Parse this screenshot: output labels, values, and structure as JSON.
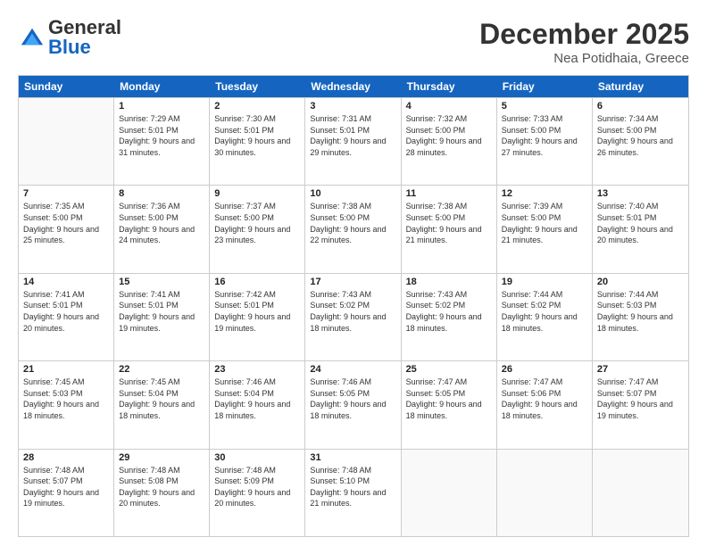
{
  "logo": {
    "general": "General",
    "blue": "Blue"
  },
  "header": {
    "month": "December 2025",
    "location": "Nea Potidhaia, Greece"
  },
  "weekdays": [
    "Sunday",
    "Monday",
    "Tuesday",
    "Wednesday",
    "Thursday",
    "Friday",
    "Saturday"
  ],
  "weeks": [
    [
      {
        "day": "",
        "empty": true
      },
      {
        "day": "1",
        "sunrise": "Sunrise: 7:29 AM",
        "sunset": "Sunset: 5:01 PM",
        "daylight": "Daylight: 9 hours and 31 minutes."
      },
      {
        "day": "2",
        "sunrise": "Sunrise: 7:30 AM",
        "sunset": "Sunset: 5:01 PM",
        "daylight": "Daylight: 9 hours and 30 minutes."
      },
      {
        "day": "3",
        "sunrise": "Sunrise: 7:31 AM",
        "sunset": "Sunset: 5:01 PM",
        "daylight": "Daylight: 9 hours and 29 minutes."
      },
      {
        "day": "4",
        "sunrise": "Sunrise: 7:32 AM",
        "sunset": "Sunset: 5:00 PM",
        "daylight": "Daylight: 9 hours and 28 minutes."
      },
      {
        "day": "5",
        "sunrise": "Sunrise: 7:33 AM",
        "sunset": "Sunset: 5:00 PM",
        "daylight": "Daylight: 9 hours and 27 minutes."
      },
      {
        "day": "6",
        "sunrise": "Sunrise: 7:34 AM",
        "sunset": "Sunset: 5:00 PM",
        "daylight": "Daylight: 9 hours and 26 minutes."
      }
    ],
    [
      {
        "day": "7",
        "sunrise": "Sunrise: 7:35 AM",
        "sunset": "Sunset: 5:00 PM",
        "daylight": "Daylight: 9 hours and 25 minutes."
      },
      {
        "day": "8",
        "sunrise": "Sunrise: 7:36 AM",
        "sunset": "Sunset: 5:00 PM",
        "daylight": "Daylight: 9 hours and 24 minutes."
      },
      {
        "day": "9",
        "sunrise": "Sunrise: 7:37 AM",
        "sunset": "Sunset: 5:00 PM",
        "daylight": "Daylight: 9 hours and 23 minutes."
      },
      {
        "day": "10",
        "sunrise": "Sunrise: 7:38 AM",
        "sunset": "Sunset: 5:00 PM",
        "daylight": "Daylight: 9 hours and 22 minutes."
      },
      {
        "day": "11",
        "sunrise": "Sunrise: 7:38 AM",
        "sunset": "Sunset: 5:00 PM",
        "daylight": "Daylight: 9 hours and 21 minutes."
      },
      {
        "day": "12",
        "sunrise": "Sunrise: 7:39 AM",
        "sunset": "Sunset: 5:00 PM",
        "daylight": "Daylight: 9 hours and 21 minutes."
      },
      {
        "day": "13",
        "sunrise": "Sunrise: 7:40 AM",
        "sunset": "Sunset: 5:01 PM",
        "daylight": "Daylight: 9 hours and 20 minutes."
      }
    ],
    [
      {
        "day": "14",
        "sunrise": "Sunrise: 7:41 AM",
        "sunset": "Sunset: 5:01 PM",
        "daylight": "Daylight: 9 hours and 20 minutes."
      },
      {
        "day": "15",
        "sunrise": "Sunrise: 7:41 AM",
        "sunset": "Sunset: 5:01 PM",
        "daylight": "Daylight: 9 hours and 19 minutes."
      },
      {
        "day": "16",
        "sunrise": "Sunrise: 7:42 AM",
        "sunset": "Sunset: 5:01 PM",
        "daylight": "Daylight: 9 hours and 19 minutes."
      },
      {
        "day": "17",
        "sunrise": "Sunrise: 7:43 AM",
        "sunset": "Sunset: 5:02 PM",
        "daylight": "Daylight: 9 hours and 18 minutes."
      },
      {
        "day": "18",
        "sunrise": "Sunrise: 7:43 AM",
        "sunset": "Sunset: 5:02 PM",
        "daylight": "Daylight: 9 hours and 18 minutes."
      },
      {
        "day": "19",
        "sunrise": "Sunrise: 7:44 AM",
        "sunset": "Sunset: 5:02 PM",
        "daylight": "Daylight: 9 hours and 18 minutes."
      },
      {
        "day": "20",
        "sunrise": "Sunrise: 7:44 AM",
        "sunset": "Sunset: 5:03 PM",
        "daylight": "Daylight: 9 hours and 18 minutes."
      }
    ],
    [
      {
        "day": "21",
        "sunrise": "Sunrise: 7:45 AM",
        "sunset": "Sunset: 5:03 PM",
        "daylight": "Daylight: 9 hours and 18 minutes."
      },
      {
        "day": "22",
        "sunrise": "Sunrise: 7:45 AM",
        "sunset": "Sunset: 5:04 PM",
        "daylight": "Daylight: 9 hours and 18 minutes."
      },
      {
        "day": "23",
        "sunrise": "Sunrise: 7:46 AM",
        "sunset": "Sunset: 5:04 PM",
        "daylight": "Daylight: 9 hours and 18 minutes."
      },
      {
        "day": "24",
        "sunrise": "Sunrise: 7:46 AM",
        "sunset": "Sunset: 5:05 PM",
        "daylight": "Daylight: 9 hours and 18 minutes."
      },
      {
        "day": "25",
        "sunrise": "Sunrise: 7:47 AM",
        "sunset": "Sunset: 5:05 PM",
        "daylight": "Daylight: 9 hours and 18 minutes."
      },
      {
        "day": "26",
        "sunrise": "Sunrise: 7:47 AM",
        "sunset": "Sunset: 5:06 PM",
        "daylight": "Daylight: 9 hours and 18 minutes."
      },
      {
        "day": "27",
        "sunrise": "Sunrise: 7:47 AM",
        "sunset": "Sunset: 5:07 PM",
        "daylight": "Daylight: 9 hours and 19 minutes."
      }
    ],
    [
      {
        "day": "28",
        "sunrise": "Sunrise: 7:48 AM",
        "sunset": "Sunset: 5:07 PM",
        "daylight": "Daylight: 9 hours and 19 minutes."
      },
      {
        "day": "29",
        "sunrise": "Sunrise: 7:48 AM",
        "sunset": "Sunset: 5:08 PM",
        "daylight": "Daylight: 9 hours and 20 minutes."
      },
      {
        "day": "30",
        "sunrise": "Sunrise: 7:48 AM",
        "sunset": "Sunset: 5:09 PM",
        "daylight": "Daylight: 9 hours and 20 minutes."
      },
      {
        "day": "31",
        "sunrise": "Sunrise: 7:48 AM",
        "sunset": "Sunset: 5:10 PM",
        "daylight": "Daylight: 9 hours and 21 minutes."
      },
      {
        "day": "",
        "empty": true
      },
      {
        "day": "",
        "empty": true
      },
      {
        "day": "",
        "empty": true
      }
    ]
  ]
}
